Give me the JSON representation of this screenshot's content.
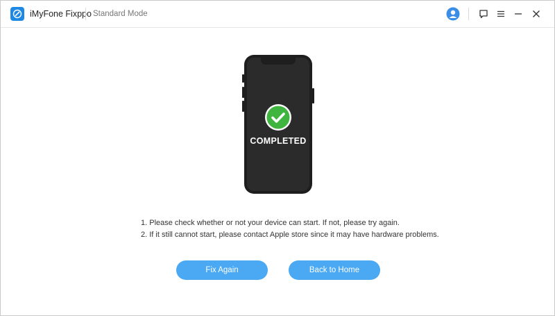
{
  "app": {
    "title": "iMyFone Fixppo",
    "mode": "Standard Mode"
  },
  "toolbar": {
    "icons": [
      "account-icon",
      "feedback-icon",
      "menu-icon",
      "minimize-icon",
      "close-icon"
    ]
  },
  "status": {
    "label": "COMPLETED"
  },
  "notes": [
    "1. Please check whether or not your device can start. If not, please try again.",
    "2. If it still cannot start, please contact Apple store since it may have hardware problems."
  ],
  "buttons": {
    "fix_again": "Fix Again",
    "back_home": "Back to Home"
  },
  "colors": {
    "accent": "#4aa9f2",
    "brand": "#1e88e5",
    "success": "#3fb43f",
    "phone": "#1e1e1e"
  }
}
